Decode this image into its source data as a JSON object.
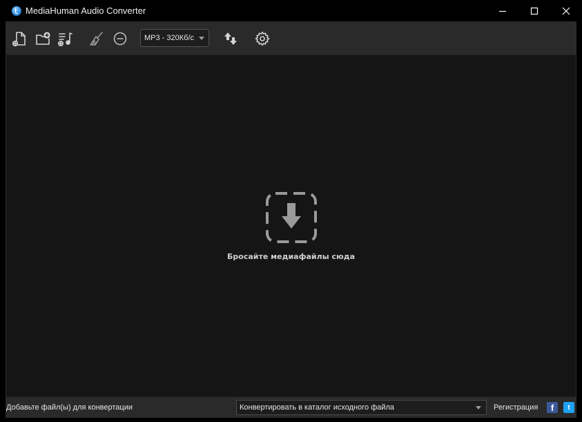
{
  "window": {
    "title": "MediaHuman Audio Converter",
    "app_icon": "mediahuman-logo-icon",
    "controls": [
      "minimize-icon",
      "maximize-icon",
      "close-icon"
    ]
  },
  "toolbar": {
    "buttons": [
      "add-file-icon",
      "add-folder-icon",
      "add-music-icon",
      "clear-list-broom-icon",
      "remove-minus-icon",
      "convert-icon",
      "settings-gear-icon"
    ],
    "format_select": {
      "value": "MP3 - 320Кб/с"
    }
  },
  "drop_zone": {
    "icon": "drop-download-icon",
    "text": "Бросайте медиафайлы сюда"
  },
  "statusbar": {
    "status_text": "Добавьте файл(ы) для конвертации",
    "destination_select": {
      "value": "Конвертировать в каталог исходного файла"
    },
    "register_label": "Регистрация",
    "facebook_glyph": "f",
    "twitter_glyph": "t"
  },
  "colors": {
    "background": "#151515",
    "toolbar": "#2a2a2a",
    "titlebar": "#000000",
    "icon": "#d4d4d4",
    "facebook": "#3b5998",
    "twitter": "#1da1f2"
  }
}
